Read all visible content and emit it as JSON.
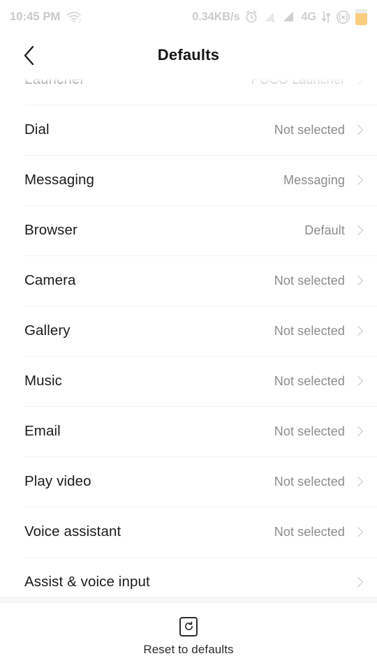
{
  "status_bar": {
    "time": "10:45 PM",
    "wifi_icon": "wifi-icon",
    "wifi_badge": "2",
    "network_speed": "0.34KB/s",
    "alarm_icon": "alarm-clock-icon",
    "sim1_icon": "signal-no-sim-icon",
    "sim2_icon": "signal-bars-icon",
    "network_type": "4G",
    "data_transfer_icon": "data-transfer-arrows-icon",
    "hotspot_icon": "hotspot-icon",
    "battery_icon": "battery-icon",
    "battery_level_pct": 72,
    "battery_color": "#fbcd7f",
    "text_color": "#c9c9c9"
  },
  "header": {
    "back_icon": "back-chevron-icon",
    "title": "Defaults"
  },
  "list": {
    "rows": [
      {
        "label": "Launcher",
        "value": "POCO Launcher",
        "clipped": true
      },
      {
        "label": "Dial",
        "value": "Not selected"
      },
      {
        "label": "Messaging",
        "value": "Messaging"
      },
      {
        "label": "Browser",
        "value": "Default"
      },
      {
        "label": "Camera",
        "value": "Not selected"
      },
      {
        "label": "Gallery",
        "value": "Not selected"
      },
      {
        "label": "Music",
        "value": "Not selected"
      },
      {
        "label": "Email",
        "value": "Not selected"
      },
      {
        "label": "Play video",
        "value": "Not selected"
      },
      {
        "label": "Voice assistant",
        "value": "Not selected"
      },
      {
        "label": "Assist & voice input",
        "value": ""
      }
    ],
    "chevron_icon": "chevron-right-icon",
    "label_color": "#1b1b1b",
    "value_color": "#8b8b8b",
    "divider_color": "#f0f0f0"
  },
  "bottom_bar": {
    "icon": "reset-restore-icon",
    "label": "Reset to defaults"
  }
}
